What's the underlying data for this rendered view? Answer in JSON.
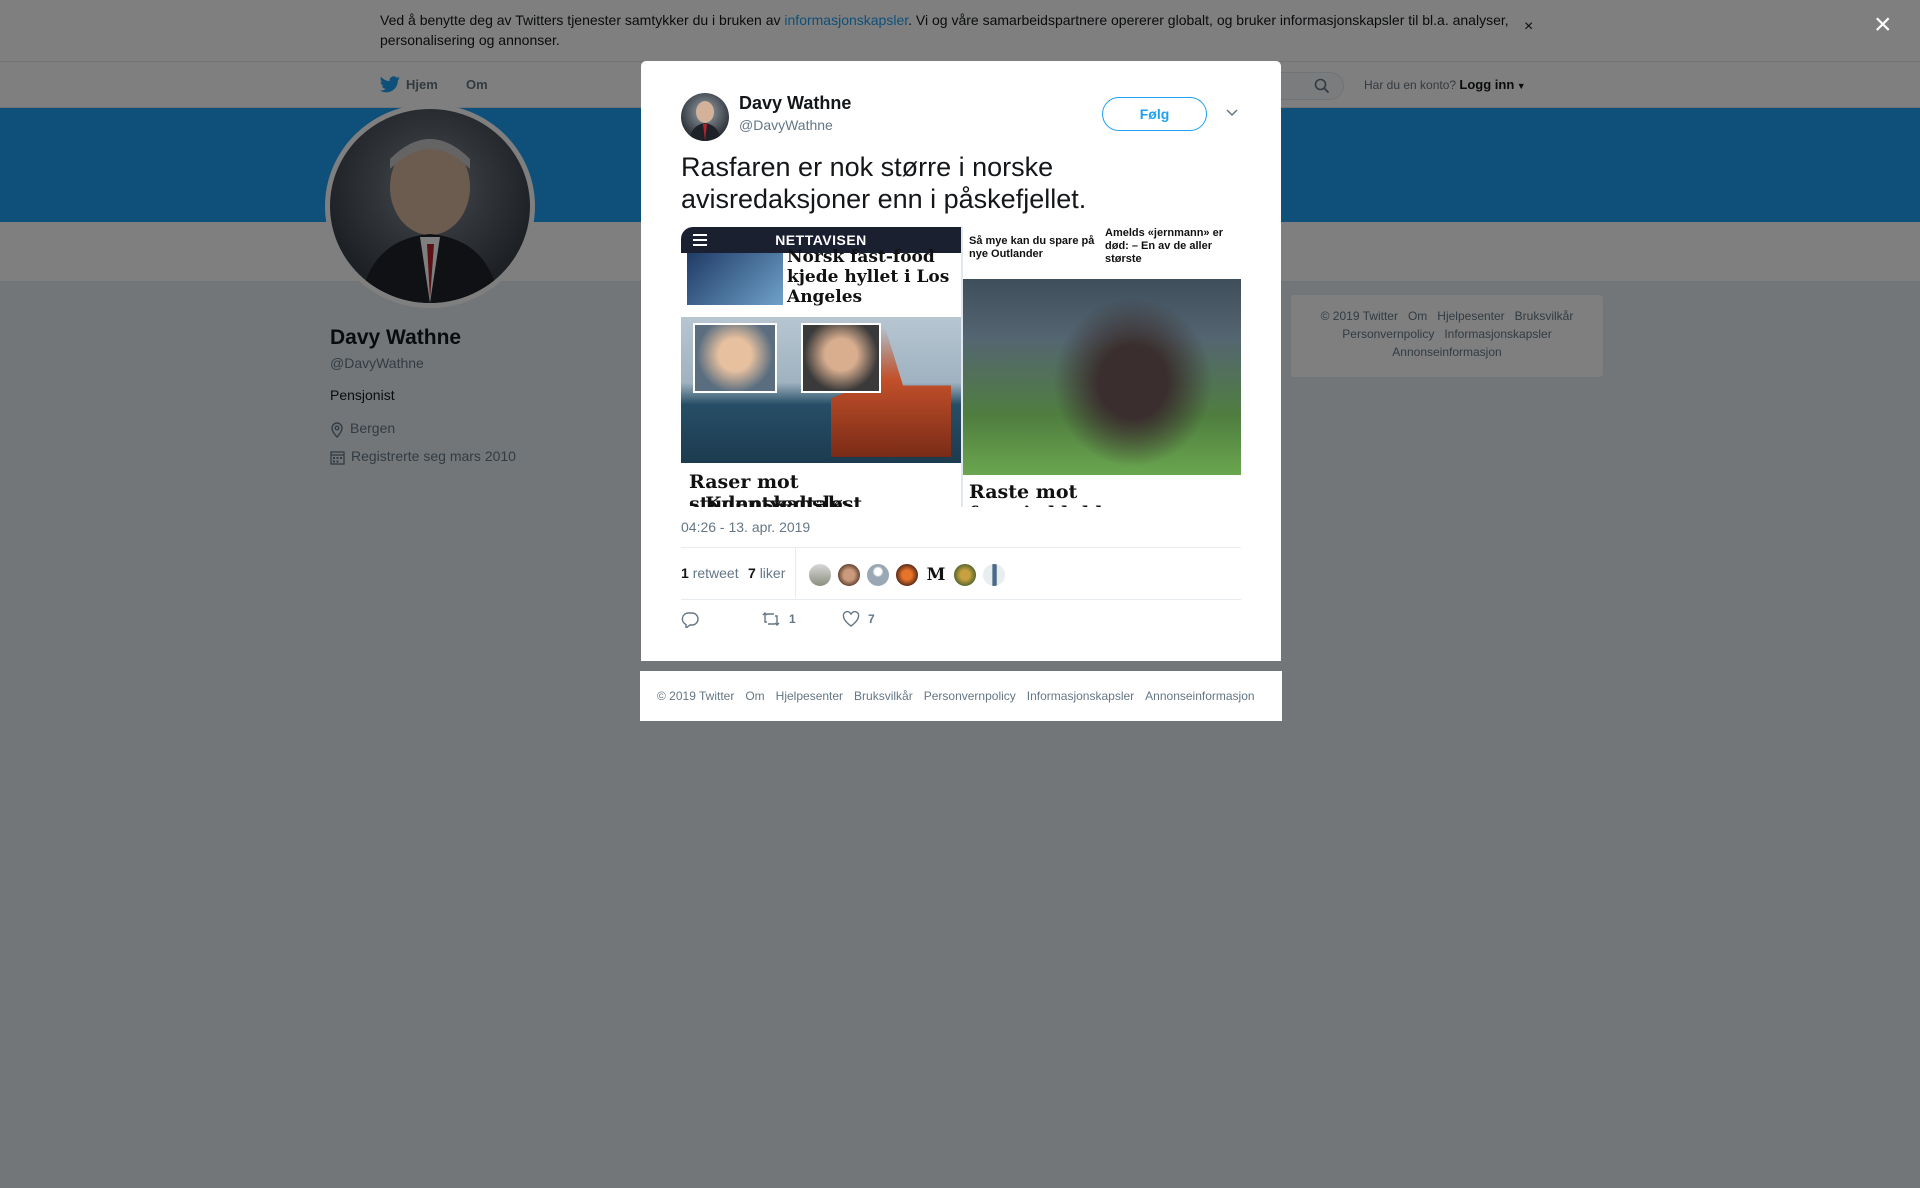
{
  "cookie": {
    "text_before": "Ved å benytte deg av Twitters tjenester samtykker du i bruken av ",
    "link": "informasjonskapsler",
    "text_after": ". Vi og våre samarbeidspartnere opererer globalt, og bruker informasjonskapsler til bl.a. analyser, personalisering og annonser.",
    "close": "×"
  },
  "nav": {
    "home": "Hjem",
    "about": "Om",
    "login_prompt": "Har du en konto?",
    "login": "Logg inn"
  },
  "profile": {
    "name": "Davy Wathne",
    "handle": "@DavyWathne",
    "bio": "Pensjonist",
    "location": "Bergen",
    "joined": "Registrerte seg mars 2010"
  },
  "side_footer": {
    "links": [
      "© 2019 Twitter",
      "Om",
      "Hjelpesenter",
      "Bruksvilkår",
      "Personvernpolicy",
      "Informasjonskapsler",
      "Annonseinformasjon"
    ]
  },
  "modal_close": "×",
  "tweet": {
    "name": "Davy Wathne",
    "handle": "@DavyWathne",
    "follow": "Følg",
    "text": "Rasfaren er nok større i norske avisredaksjoner enn i påskefjellet.",
    "media": {
      "left": {
        "masthead": "NETTAVISEN",
        "headline1": "Norsk fast-food kjede hyllet i Los Angeles",
        "headline2": "Raser mot studentvedtak:",
        "headline2b": "– Kunnskapsløst"
      },
      "right": {
        "top_left": "Så mye kan du spare på nye Outlander",
        "top_right": "Amelds «jernmann» er død: – En av de aller største",
        "headline": "Raste mot favorittklubben:"
      }
    },
    "timestamp": "04:26 - 13. apr. 2019",
    "retweets": "1",
    "retweets_label": "retweet",
    "likes": "7",
    "likes_label": "liker",
    "action_reply_count": "",
    "action_retweet_count": "1",
    "action_like_count": "7"
  },
  "modal_footer": {
    "links": [
      "© 2019 Twitter",
      "Om",
      "Hjelpesenter",
      "Bruksvilkår",
      "Personvernpolicy",
      "Informasjonskapsler",
      "Annonseinformasjon"
    ]
  },
  "colors": {
    "accent": "#1da1f2",
    "banner": "#1da1f2",
    "overlay": "rgba(0,0,0,0.5)"
  },
  "icons": [
    "twitter-bird-icon",
    "search-icon",
    "caret-down-icon",
    "location-pin-icon",
    "calendar-icon",
    "chevron-down-icon",
    "reply-icon",
    "retweet-icon",
    "heart-icon",
    "close-icon"
  ]
}
